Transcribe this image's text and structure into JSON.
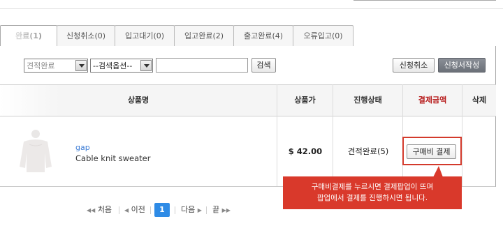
{
  "tabs": [
    {
      "label": "완료(1)",
      "active": true
    },
    {
      "label": "신청취소(0)",
      "active": false
    },
    {
      "label": "입고대기(0)",
      "active": false
    },
    {
      "label": "입고완료(2)",
      "active": false
    },
    {
      "label": "출고완료(4)",
      "active": false
    },
    {
      "label": "오류입고(0)",
      "active": false
    }
  ],
  "filter": {
    "status_select": "견적완료",
    "option_select": "--검색옵션--",
    "search_value": "",
    "search_button": "검색",
    "cancel_button": "신청취소",
    "write_button": "신청서작성"
  },
  "table": {
    "headers": {
      "product": "상품명",
      "price": "상품가",
      "status": "진행상태",
      "payment": "결제금액",
      "delete": "삭제"
    },
    "rows": [
      {
        "brand": "gap",
        "name": "Cable knit sweater",
        "price": "$ 42.00",
        "status": "견적완료(5)",
        "pay_button": "구매비 결제"
      }
    ]
  },
  "tooltip": {
    "line1": "구매비결제를 누르시면 결제팝업이 뜨며",
    "line2": "팝업에서 결제를 진행하시면 됩니다."
  },
  "pagination": {
    "first": "처음",
    "prev": "이전",
    "current": "1",
    "next": "다음",
    "last": "끝"
  },
  "colors": {
    "accent_red": "#d9392b",
    "link_blue": "#3a7bd5",
    "page_active": "#2e8be6"
  }
}
